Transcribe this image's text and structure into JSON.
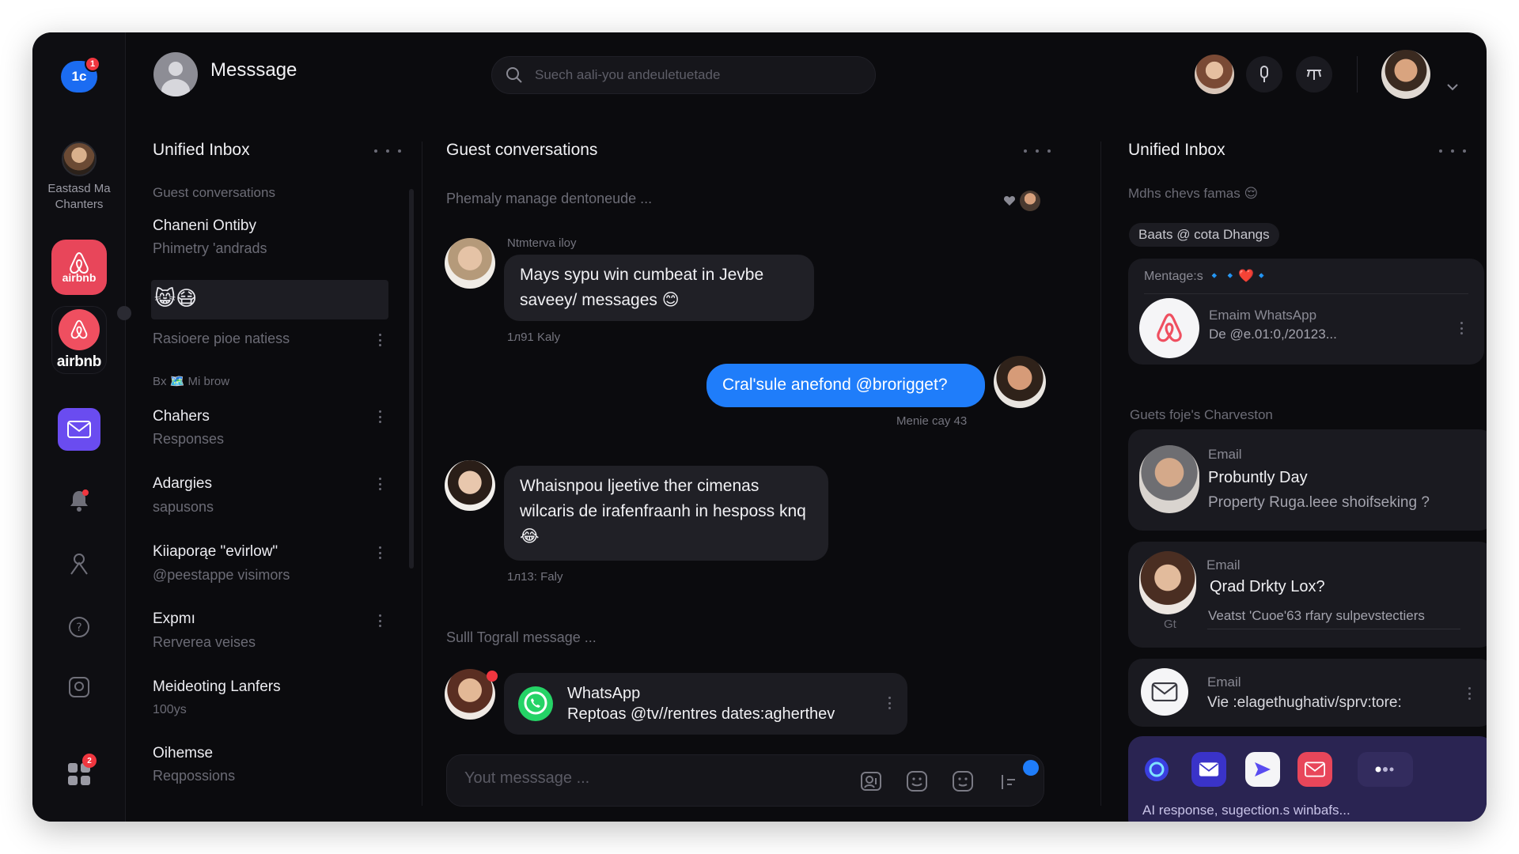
{
  "app": {
    "logo_text": "1c",
    "logo_badge": "1",
    "title": "Messsage"
  },
  "search": {
    "placeholder": "Suech aali-you andeuletuetade"
  },
  "rail": {
    "user_name": "Eastasd Ma Chanters",
    "airbnb_label": "airbnb",
    "airbnb_label_small": "airbnb",
    "grid_badge": "2"
  },
  "left_panel": {
    "title": "Unified Inbox",
    "section_guest": "Guest conversations",
    "items": [
      {
        "title": "Chaneni Ontiby",
        "sub": "Phimetry 'andrads"
      },
      {
        "title": "",
        "sub": "Rasioere pioe natiess"
      },
      {
        "title": "Chahers",
        "sub": "Responses"
      },
      {
        "title": "Adargies",
        "sub": "sapusons"
      },
      {
        "title": "Kiiaporąe \"evirlow\"",
        "sub": "@peestappe visimors"
      },
      {
        "title": "Expmı",
        "sub": "Rerverea veises"
      },
      {
        "title": "Meideoting Lanfers",
        "sub": "100ys"
      },
      {
        "title": "Oihemse",
        "sub": "Reqpossions"
      }
    ],
    "section_mid": "Bx 🗺️ Mi brow",
    "emojis": "😸😷"
  },
  "mid_panel": {
    "title": "Guest conversations",
    "subheading": "Phemaly manage dentoneude ...",
    "sender1": "Ntmterva iloy",
    "msg1": "Mays sypu win cumbeat in Jevbe saveey/ messages 😊",
    "time1": "1л91 Kaly",
    "msg2": "Cral'sule anefond @brorigget?",
    "time2": "Menie cay 43",
    "msg3": "Whaisnpou ljeetive ther cimenas wilcaris de irafenfraanh in hesposs knq 😂",
    "time3": "1л13: Faly",
    "section_bottom": "Sulll Tograll message ...",
    "wa_title": "WhatsApp",
    "wa_sub": "Reptoas @tv//rentres dates:agherthev",
    "composer_placeholder": "Yout messsage ..."
  },
  "right_panel": {
    "title": "Unified Inbox",
    "sub_heading": "Mdhs chevs famas 😌",
    "chip": "Baats @ cota Dhangs",
    "card1_header": "Mentage:s 🔹🔹❤️🔹",
    "card1_label": "Emaim WhatsApp",
    "card1_sub": "De @e.01:0,/20123...",
    "section2": "Guets foje's Charveston",
    "card2_label": "Email",
    "card2_title": "Probuntly Day",
    "card2_sub": "Property Ruga.leee shoifseking ?",
    "card3_label": "Email",
    "card3_title": "Qrad Drkty Lox?",
    "card3_sub": "Veatst 'Cuoe'63 rfary sulpevstectiers",
    "card3_tag": "Gt",
    "card4_label": "Email",
    "card4_sub": "Vie :elagethughativ/sprv:tore:",
    "ai_text": "AI response, sugection.s winbafs..."
  },
  "colors": {
    "accent_blue": "#1f7dfa",
    "airbnb": "#ef4f60",
    "mail_purple": "#6a4cf0",
    "whatsapp": "#25d366",
    "ai_panel": "#2a2452"
  }
}
